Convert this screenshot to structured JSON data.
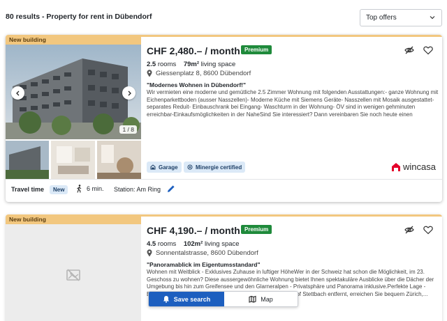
{
  "header": {
    "results_title": "80 results - Property for rent in Dübendorf",
    "sort_label": "Top offers"
  },
  "listings": [
    {
      "badge": "New building",
      "price": "CHF 2,480.– / month",
      "premium": "Premium",
      "rooms_value": "2.5",
      "rooms_label": "rooms",
      "area_value": "79m²",
      "area_label": "living space",
      "address": "Giessenplatz 8, 8600 Dübendorf",
      "headline": "\"Modernes Wohnen in Dübendorf!\"",
      "description": "Wir vermieten eine moderne und gemütliche 2.5 Zimmer Wohnung mit folgenden Ausstattungen:- ganze Wohnung mit Eichenparkettboden (ausser Nasszellen)- Moderne Küche mit Siemens Geräte- Nasszellen mit Mosaik ausgestattet-separates Reduit- Einbauschrank bei Eingang- Waschturm in der Wohnung- ÖV sind in wenigen gehminuten erreichbar-Einkaufsmöglichkeiten in der NaheSind Sie interessiert? Dann vereinbaren Sie noch heute einen Besichtigungstermin...",
      "image_counter": "1 / 8",
      "tags": [
        "Garage",
        "Minergie certified"
      ],
      "agency_logo": "wincasa",
      "travel_label": "Travel time",
      "travel_new": "New",
      "travel_minutes": "6 min.",
      "travel_station": "Station: Am Ring"
    },
    {
      "badge": "New building",
      "price": "CHF 4,190.– / month",
      "premium": "Premium",
      "rooms_value": "4.5",
      "rooms_label": "rooms",
      "area_value": "102m²",
      "area_label": "living space",
      "address": "Sonnentalstrasse, 8600 Dübendorf",
      "headline": "\"Panoramablick im Eigentumsstandard\"",
      "description": "Wohnen mit Weitblick - Exklusives Zuhause in luftiger HöheWer in der Schweiz hat schon die Möglichkeit, im 23. Geschoss zu wohnen? Diese aussergewöhnliche Wohnung bietet Ihnen spektakuläre Ausblicke über die Dächer der Umgebung bis hin zum Greifensee und den Glarneralpen - Privatsphäre und Panorama inklusive.Perfekte Lage - Erstklassige Anbindung Nur wenige Gehminuten vom Bahnhof Stettbach entfernt, erreichen Sie bequem Zürich,..."
    }
  ],
  "floating": {
    "save_search": "Save search",
    "map": "Map"
  },
  "colors": {
    "premium": "#1f8a3b",
    "new_building": "#f2c77f",
    "primary_button": "#1d5fbf",
    "tag_bg": "#dbe9f7"
  }
}
